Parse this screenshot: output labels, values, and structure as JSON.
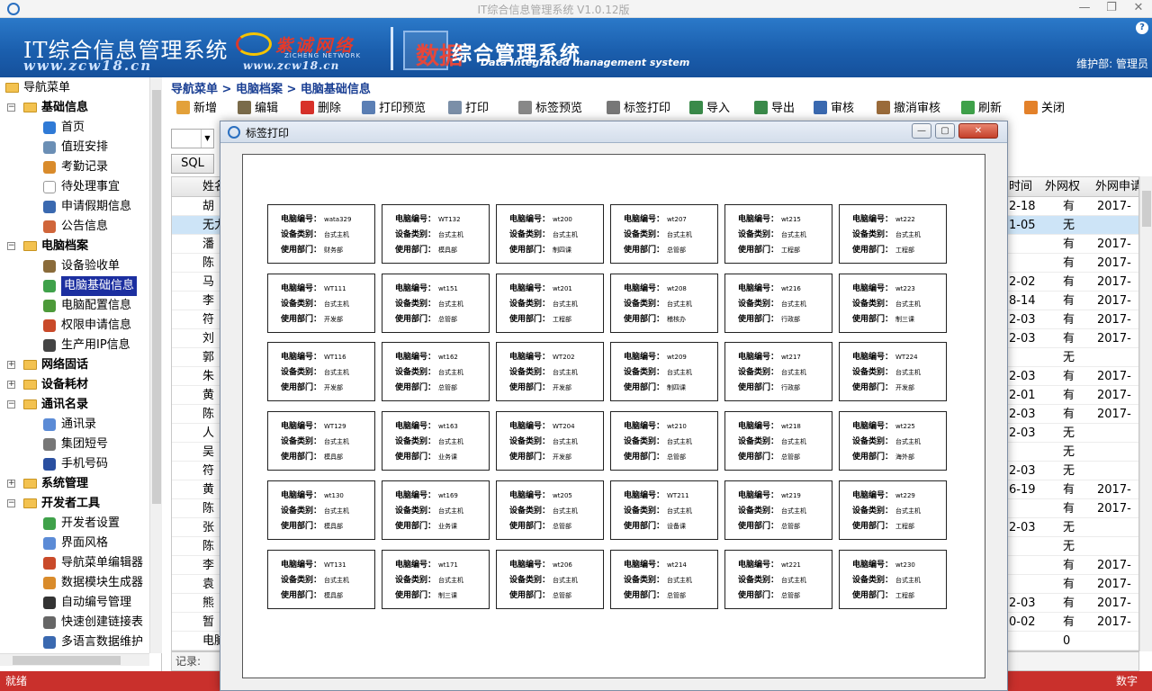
{
  "window": {
    "title": "IT综合信息管理系统 V1.0.12版",
    "minimize": "—",
    "restore": "❐",
    "close": "✕"
  },
  "banner": {
    "system_title": "IT综合信息管理系统",
    "system_url": "www.zcw18.cn",
    "brand_cn": "紫诚网络",
    "brand_en": "ZICHENG NETWORK",
    "brand_url": "www.zcw18.cn",
    "slogan_a": "数据",
    "slogan_b": "综合管理系统",
    "slogan_en": "Data integrated management system",
    "user": "维护部: 管理员",
    "help": "?"
  },
  "sidebar": {
    "nodes": [
      {
        "label": "导航菜单",
        "level": 0,
        "kind": "root",
        "name": "nav-menu-root"
      },
      {
        "label": "基础信息",
        "level": 1,
        "kind": "group",
        "name": "group-basic-info"
      },
      {
        "label": "首页",
        "level": 2,
        "kind": "leaf",
        "icon": "#2f7ad6",
        "name": "item-home"
      },
      {
        "label": "值班安排",
        "level": 2,
        "kind": "leaf",
        "icon": "#6b8fb5",
        "name": "item-duty"
      },
      {
        "label": "考勤记录",
        "level": 2,
        "kind": "leaf",
        "icon": "#d98b2b",
        "name": "item-attendance"
      },
      {
        "label": "待处理事宜",
        "level": 2,
        "kind": "leaf",
        "icon": "#ffffff",
        "name": "item-pending"
      },
      {
        "label": "申请假期信息",
        "level": 2,
        "kind": "leaf",
        "icon": "#3a69b0",
        "name": "item-leave"
      },
      {
        "label": "公告信息",
        "level": 2,
        "kind": "leaf",
        "icon": "#d0653a",
        "name": "item-notice"
      },
      {
        "label": "电脑档案",
        "level": 1,
        "kind": "group",
        "name": "group-pc-archive"
      },
      {
        "label": "设备验收单",
        "level": 2,
        "kind": "leaf",
        "icon": "#8a6b3a",
        "name": "item-acceptance"
      },
      {
        "label": "电脑基础信息",
        "level": 2,
        "kind": "leaf",
        "icon": "#3fa14a",
        "name": "item-pc-basic",
        "selected": true
      },
      {
        "label": "电脑配置信息",
        "level": 2,
        "kind": "leaf",
        "icon": "#4d9a3a",
        "name": "item-pc-config"
      },
      {
        "label": "权限申请信息",
        "level": 2,
        "kind": "leaf",
        "icon": "#c94a2a",
        "name": "item-permission"
      },
      {
        "label": "生产用IP信息",
        "level": 2,
        "kind": "leaf",
        "icon": "#444444",
        "name": "item-ip"
      },
      {
        "label": "网络固话",
        "level": 1,
        "kind": "group-collapsed",
        "name": "group-network-phone"
      },
      {
        "label": "设备耗材",
        "level": 1,
        "kind": "group-collapsed",
        "name": "group-consumables"
      },
      {
        "label": "通讯名录",
        "level": 1,
        "kind": "group",
        "name": "group-directory"
      },
      {
        "label": "通讯录",
        "level": 2,
        "kind": "leaf",
        "icon": "#5b8bd6",
        "name": "item-contacts"
      },
      {
        "label": "集团短号",
        "level": 2,
        "kind": "leaf",
        "icon": "#777777",
        "name": "item-short-number"
      },
      {
        "label": "手机号码",
        "level": 2,
        "kind": "leaf",
        "icon": "#2a4fa0",
        "name": "item-mobile"
      },
      {
        "label": "系统管理",
        "level": 1,
        "kind": "group-collapsed",
        "name": "group-system"
      },
      {
        "label": "开发者工具",
        "level": 1,
        "kind": "group",
        "name": "group-dev-tools"
      },
      {
        "label": "开发者设置",
        "level": 2,
        "kind": "leaf",
        "icon": "#3fa14a",
        "name": "item-dev-settings"
      },
      {
        "label": "界面风格",
        "level": 2,
        "kind": "leaf",
        "icon": "#5b8bd6",
        "name": "item-ui-style"
      },
      {
        "label": "导航菜单编辑器",
        "level": 2,
        "kind": "leaf",
        "icon": "#c94a2a",
        "name": "item-menu-editor"
      },
      {
        "label": "数据模块生成器",
        "level": 2,
        "kind": "leaf",
        "icon": "#d98b2b",
        "name": "item-module-gen"
      },
      {
        "label": "自动编号管理",
        "level": 2,
        "kind": "leaf",
        "icon": "#333333",
        "name": "item-auto-number"
      },
      {
        "label": "快速创建链接表",
        "level": 2,
        "kind": "leaf",
        "icon": "#666666",
        "name": "item-link-table"
      },
      {
        "label": "多语言数据维护",
        "level": 2,
        "kind": "leaf",
        "icon": "#3a69b0",
        "name": "item-i18n"
      }
    ]
  },
  "breadcrumb": "导航菜单 > 电脑档案 > 电脑基础信息",
  "toolbar": [
    {
      "label": "新增",
      "icon": "#e3a13a",
      "name": "add-button"
    },
    {
      "label": "编辑",
      "icon": "#7a6b4a",
      "name": "edit-button"
    },
    {
      "label": "删除",
      "icon": "#d8312a",
      "name": "delete-button"
    },
    {
      "label": "打印预览",
      "icon": "#5b7fb5",
      "name": "print-preview-button"
    },
    {
      "label": "打印",
      "icon": "#7b8fa8",
      "name": "print-button"
    },
    {
      "label": "标签预览",
      "icon": "#888888",
      "name": "label-preview-button"
    },
    {
      "label": "标签打印",
      "icon": "#777777",
      "name": "label-print-button"
    },
    {
      "label": "导入",
      "icon": "#3a8a4a",
      "name": "import-button"
    },
    {
      "label": "导出",
      "icon": "#3a8a4a",
      "name": "export-button"
    },
    {
      "label": "审核",
      "icon": "#3a69b0",
      "name": "audit-button"
    },
    {
      "label": "撤消审核",
      "icon": "#9a6b3a",
      "name": "cancel-audit-button"
    },
    {
      "label": "刷新",
      "icon": "#3fa14a",
      "name": "refresh-button"
    },
    {
      "label": "关闭",
      "icon": "#e3812a",
      "name": "close-button"
    }
  ],
  "sql_button": "SQL",
  "grid": {
    "col_name_header": "姓名",
    "col_time_header": "时间",
    "col_extnet_header": "外网权",
    "col_extdate_header": "外网申请",
    "name_col": [
      "胡",
      "无力",
      "潘",
      "陈",
      "马",
      "李",
      "符",
      "刘",
      "郭",
      "朱",
      "黄",
      "陈",
      "人",
      "吴",
      "符",
      "黄",
      "陈",
      "张",
      "陈",
      "李",
      "袁",
      "熊",
      "暂",
      "电脑"
    ],
    "time_col": [
      "2-18",
      "1-05",
      "",
      "",
      "2-02",
      "8-14",
      "2-03",
      "2-03",
      "",
      "2-03",
      "2-01",
      "2-03",
      "2-03",
      "",
      "2-03",
      "6-19",
      "",
      "2-03",
      "",
      "",
      "",
      "2-03",
      "0-02",
      ""
    ],
    "ext_col": [
      "有",
      "无",
      "有",
      "有",
      "有",
      "有",
      "有",
      "有",
      "无",
      "有",
      "有",
      "有",
      "无",
      "无",
      "无",
      "有",
      "有",
      "无",
      "无",
      "有",
      "有",
      "有",
      "有",
      "0"
    ],
    "date_col": [
      "2017-",
      "",
      "2017-",
      "2017-",
      "2017-",
      "2017-",
      "2017-",
      "2017-",
      "",
      "2017-",
      "2017-",
      "2017-",
      "",
      "",
      "",
      "2017-",
      "2017-",
      "",
      "",
      "2017-",
      "2017-",
      "2017-",
      "2017-",
      ""
    ],
    "highlight_row": 1,
    "record_label": "记录:"
  },
  "status": {
    "left": "就绪",
    "right": "数字"
  },
  "dialog": {
    "title": "标签打印",
    "field_pc": "电脑编号：",
    "field_type": "设备类别：",
    "field_dept": "使用部门：",
    "labels": [
      [
        "wata329",
        "台式主机",
        "财务部"
      ],
      [
        "WT132",
        "台式主机",
        "模具部"
      ],
      [
        "wt200",
        "台式主机",
        "制四课"
      ],
      [
        "wt207",
        "台式主机",
        "总管部"
      ],
      [
        "wt215",
        "台式主机",
        "工程部"
      ],
      [
        "wt222",
        "台式主机",
        "工程部"
      ],
      [
        "WT111",
        "台式主机",
        "开发部"
      ],
      [
        "wt151",
        "台式主机",
        "总管部"
      ],
      [
        "wt201",
        "台式主机",
        "工程部"
      ],
      [
        "wt208",
        "台式主机",
        "稽核办"
      ],
      [
        "wt216",
        "台式主机",
        "行政部"
      ],
      [
        "wt223",
        "台式主机",
        "制三课"
      ],
      [
        "WT116",
        "台式主机",
        "开发部"
      ],
      [
        "wt162",
        "台式主机",
        "总管部"
      ],
      [
        "WT202",
        "台式主机",
        "开发部"
      ],
      [
        "wt209",
        "台式主机",
        "制四课"
      ],
      [
        "wt217",
        "台式主机",
        "行政部"
      ],
      [
        "WT224",
        "台式主机",
        "开发部"
      ],
      [
        "WT129",
        "台式主机",
        "模具部"
      ],
      [
        "wt163",
        "台式主机",
        "业务课"
      ],
      [
        "WT204",
        "台式主机",
        "开发部"
      ],
      [
        "wt210",
        "台式主机",
        "总管部"
      ],
      [
        "wt218",
        "台式主机",
        "总管部"
      ],
      [
        "wt225",
        "台式主机",
        "海外部"
      ],
      [
        "wt130",
        "台式主机",
        "模具部"
      ],
      [
        "wt169",
        "台式主机",
        "业务课"
      ],
      [
        "wt205",
        "台式主机",
        "总管部"
      ],
      [
        "WT211",
        "台式主机",
        "设备课"
      ],
      [
        "wt219",
        "台式主机",
        "总管部"
      ],
      [
        "wt229",
        "台式主机",
        "工程部"
      ],
      [
        "WT131",
        "台式主机",
        "模具部"
      ],
      [
        "wt171",
        "台式主机",
        "制三课"
      ],
      [
        "wt206",
        "台式主机",
        "总管部"
      ],
      [
        "wt214",
        "台式主机",
        "总管部"
      ],
      [
        "wt221",
        "台式主机",
        "总管部"
      ],
      [
        "wt230",
        "台式主机",
        "工程部"
      ]
    ]
  }
}
